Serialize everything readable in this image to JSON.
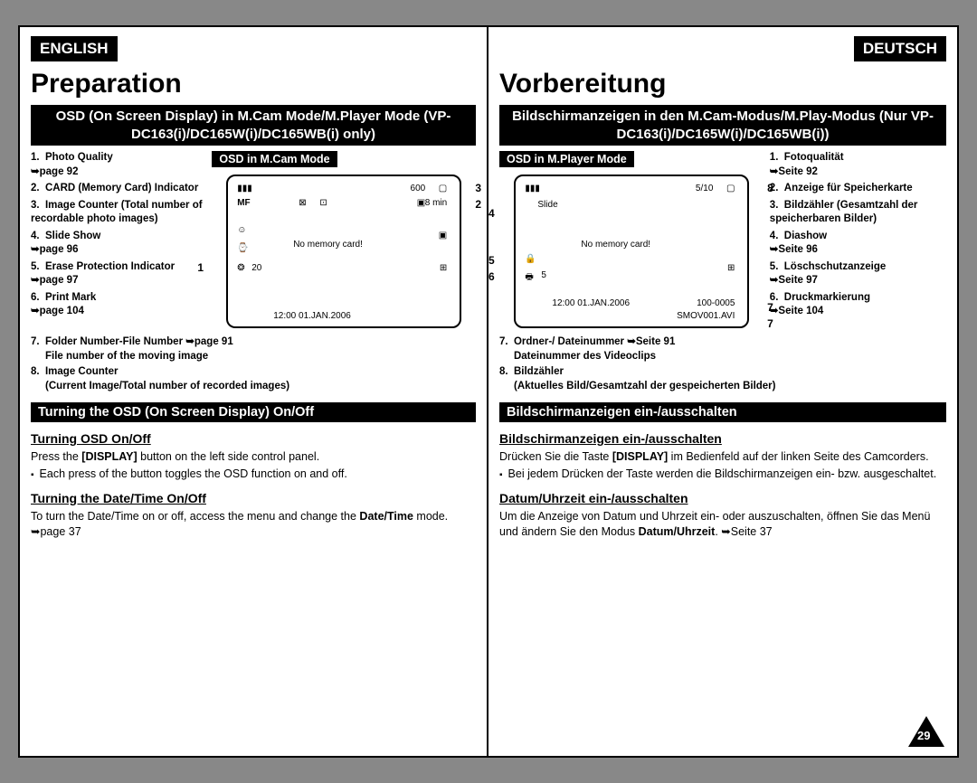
{
  "page_number": "29",
  "en": {
    "lang": "ENGLISH",
    "title": "Preparation",
    "band": "OSD (On Screen Display) in M.Cam Mode/M.Player Mode (VP-DC163(i)/DC165W(i)/DC165WB(i) only)",
    "osd_label": "OSD in M.Cam Mode",
    "list": {
      "i1": "Photo Quality",
      "i1r": "➥page 92",
      "i2": "CARD (Memory Card) Indicator",
      "i3": "Image Counter (Total number of recordable photo images)",
      "i4": "Slide Show",
      "i4r": "➥page 96",
      "i5": "Erase Protection Indicator",
      "i5r": "➥page 97",
      "i6": "Print Mark",
      "i6r": "➥page 104",
      "i7": "Folder Number-File Number ➥page 91",
      "i7b": "File number of the moving image",
      "i8": "Image Counter",
      "i8b": "(Current Image/Total number of recorded images)"
    },
    "screen": {
      "c600": "600",
      "min8": "8 min",
      "nomem": "No memory card!",
      "t20": "20",
      "dt": "12:00 01.JAN.2006"
    },
    "call": {
      "c1": "1",
      "c2": "2",
      "c3": "3"
    },
    "band2": "Turning the OSD (On Screen Display) On/Off",
    "sub1": "Turning OSD On/Off",
    "body1a": "Press the ",
    "body1key": "[DISPLAY]",
    "body1b": " button on the left side control panel.",
    "body1bul": "Each press of the button toggles the OSD function on and off.",
    "sub2": "Turning the Date/Time On/Off",
    "body2a": "To turn the Date/Time on or off, access the menu and change the ",
    "body2key": "Date/Time",
    "body2b": " mode. ➥page 37"
  },
  "de": {
    "lang": "DEUTSCH",
    "title": "Vorbereitung",
    "band": "Bildschirmanzeigen in den M.Cam-Modus/M.Play-Modus (Nur VP-DC163(i)/DC165W(i)/DC165WB(i))",
    "osd_label": "OSD in M.Player Mode",
    "list": {
      "i1": "Fotoqualität",
      "i1r": "➥Seite 92",
      "i2": "Anzeige für Speicherkarte",
      "i3": "Bildzähler (Gesamtzahl der speicherbaren Bilder)",
      "i4": "Diashow",
      "i4r": "➥Seite 96",
      "i5": "Löschschutzanzeige",
      "i5r": "➥Seite 97",
      "i6": "Druckmarkierung",
      "i6r": "➥Seite 104",
      "i7": "Ordner-/ Dateinummer ➥Seite 91",
      "i7b": "Dateinummer des Videoclips",
      "i8": "Bildzähler",
      "i8b": "(Aktuelles Bild/Gesamtzahl der gespeicherten Bilder)"
    },
    "screen": {
      "c510": "5/10",
      "slide": "Slide",
      "nomem": "No memory card!",
      "t5": "5",
      "dt": "12:00 01.JAN.2006",
      "folder": "100-0005",
      "avi": "SMOV001.AVI"
    },
    "call": {
      "c4": "4",
      "c5": "5",
      "c6": "6",
      "c7": "7",
      "c7b": "7",
      "c8": "8"
    },
    "band2": "Bildschirmanzeigen ein-/ausschalten",
    "sub1": "Bildschirmanzeigen ein-/ausschalten",
    "body1a": "Drücken Sie die Taste ",
    "body1key": "[DISPLAY]",
    "body1b": " im Bedienfeld auf der linken Seite des Camcorders.",
    "body1bul": "Bei jedem Drücken der Taste werden die Bildschirmanzeigen ein- bzw. ausgeschaltet.",
    "sub2": "Datum/Uhrzeit ein-/ausschalten",
    "body2a": "Um die Anzeige von Datum und Uhrzeit ein- oder auszuschalten, öffnen Sie das Menü und ändern Sie den Modus ",
    "body2key": "Datum/Uhrzeit",
    "body2b": ". ➥Seite 37"
  }
}
